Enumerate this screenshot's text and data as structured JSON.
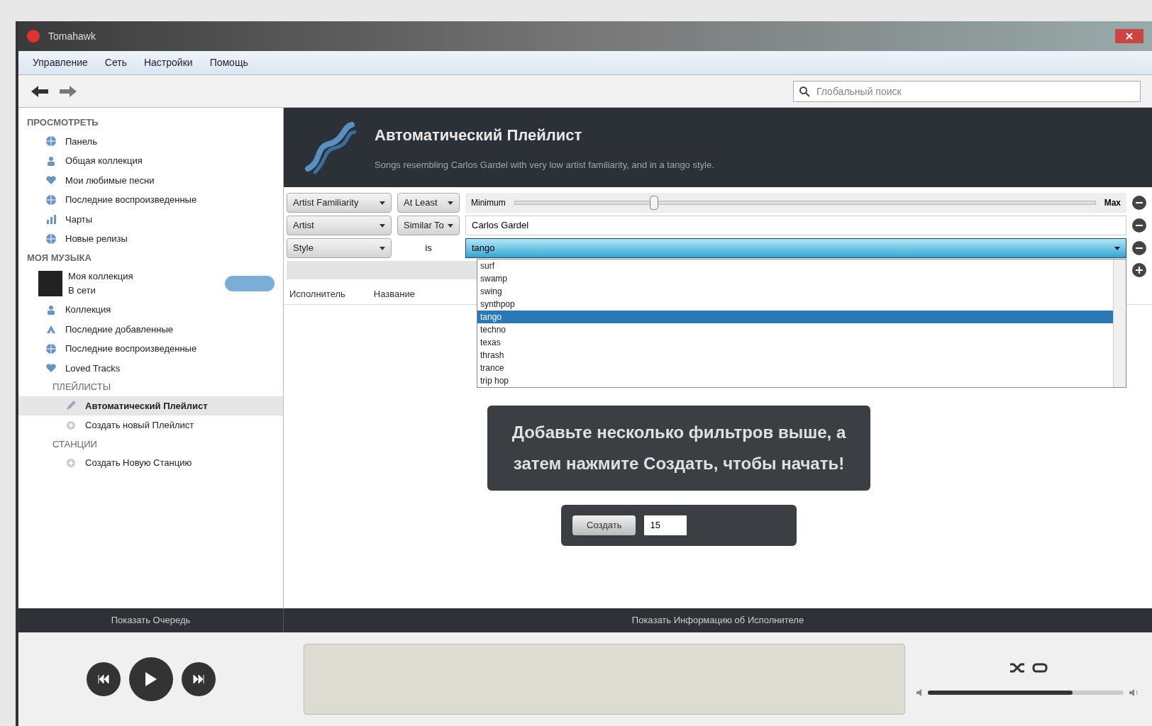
{
  "window": {
    "title": "Tomahawk"
  },
  "menu": [
    "Управление",
    "Сеть",
    "Настройки",
    "Помощь"
  ],
  "search": {
    "placeholder": "Глобальный поиск"
  },
  "sidebar": {
    "sections": [
      {
        "title": "ПРОСМОТРЕТЬ",
        "items": [
          {
            "label": "Панель",
            "kind": "globe",
            "selected": false
          },
          {
            "label": "Общая коллекция",
            "kind": "people",
            "selected": false
          },
          {
            "label": "Мои любимые песни",
            "kind": "heart",
            "selected": false
          },
          {
            "label": "Последние воспроизведенные",
            "kind": "globe",
            "selected": false
          },
          {
            "label": "Чарты",
            "kind": "chart",
            "selected": false
          },
          {
            "label": "Новые релизы",
            "kind": "globe",
            "selected": false
          }
        ]
      },
      {
        "title": "МОЯ МУЗЫКА",
        "account": {
          "name": "Моя коллекция",
          "status": "В сети"
        },
        "items": [
          {
            "label": "Коллекция",
            "kind": "people",
            "selected": false
          },
          {
            "label": "Последние добавленные",
            "kind": "up",
            "selected": false
          },
          {
            "label": "Последние воспроизведенные",
            "kind": "globe",
            "selected": false
          },
          {
            "label": "Loved Tracks",
            "kind": "heart",
            "selected": false
          }
        ]
      },
      {
        "title": "ПЛЕЙЛИСТЫ",
        "items": [
          {
            "label": "Автоматический Плейлист",
            "kind": "pen",
            "selected": true
          },
          {
            "label": "Создать новый Плейлист",
            "kind": "plus",
            "selected": false
          }
        ]
      },
      {
        "title": "СТАНЦИИ",
        "items": [
          {
            "label": "Создать Новую Станцию",
            "kind": "plus",
            "selected": false
          }
        ]
      }
    ]
  },
  "header": {
    "title": "Автоматический Плейлист",
    "subtitle": "Songs resembling Carlos Gardel with very low artist familiarity, and in a tango style."
  },
  "filters": [
    {
      "kind": "slider",
      "field": "Artist Familiarity",
      "operator": "At Least",
      "min_label": "Minimum",
      "max_label": "Max",
      "level": 0.24
    },
    {
      "kind": "text",
      "field": "Artist",
      "operator": "Similar To",
      "value": "Carlos Gardel"
    },
    {
      "kind": "select",
      "field": "Style",
      "operator": "is",
      "value": "tango"
    },
    {
      "kind": "empty"
    }
  ],
  "style_options": [
    {
      "label": "surf",
      "selected": false
    },
    {
      "label": "swamp",
      "selected": false
    },
    {
      "label": "swing",
      "selected": false
    },
    {
      "label": "synthpop",
      "selected": false
    },
    {
      "label": "tango",
      "selected": true
    },
    {
      "label": "techno",
      "selected": false
    },
    {
      "label": "texas",
      "selected": false
    },
    {
      "label": "thrash",
      "selected": false
    },
    {
      "label": "trance",
      "selected": false
    },
    {
      "label": "trip hop",
      "selected": false
    }
  ],
  "table": {
    "columns": [
      "Исполнитель",
      "Название"
    ]
  },
  "message": "Добавьте несколько фильтров выше, а затем нажмите Создать, чтобы начать!",
  "create": {
    "button": "Создать",
    "count": "15"
  },
  "bottom_bar": {
    "left": "Показать Очередь",
    "right": "Показать Информацию об Исполнителе"
  },
  "player": {
    "volume": {
      "level": 0.74
    }
  }
}
